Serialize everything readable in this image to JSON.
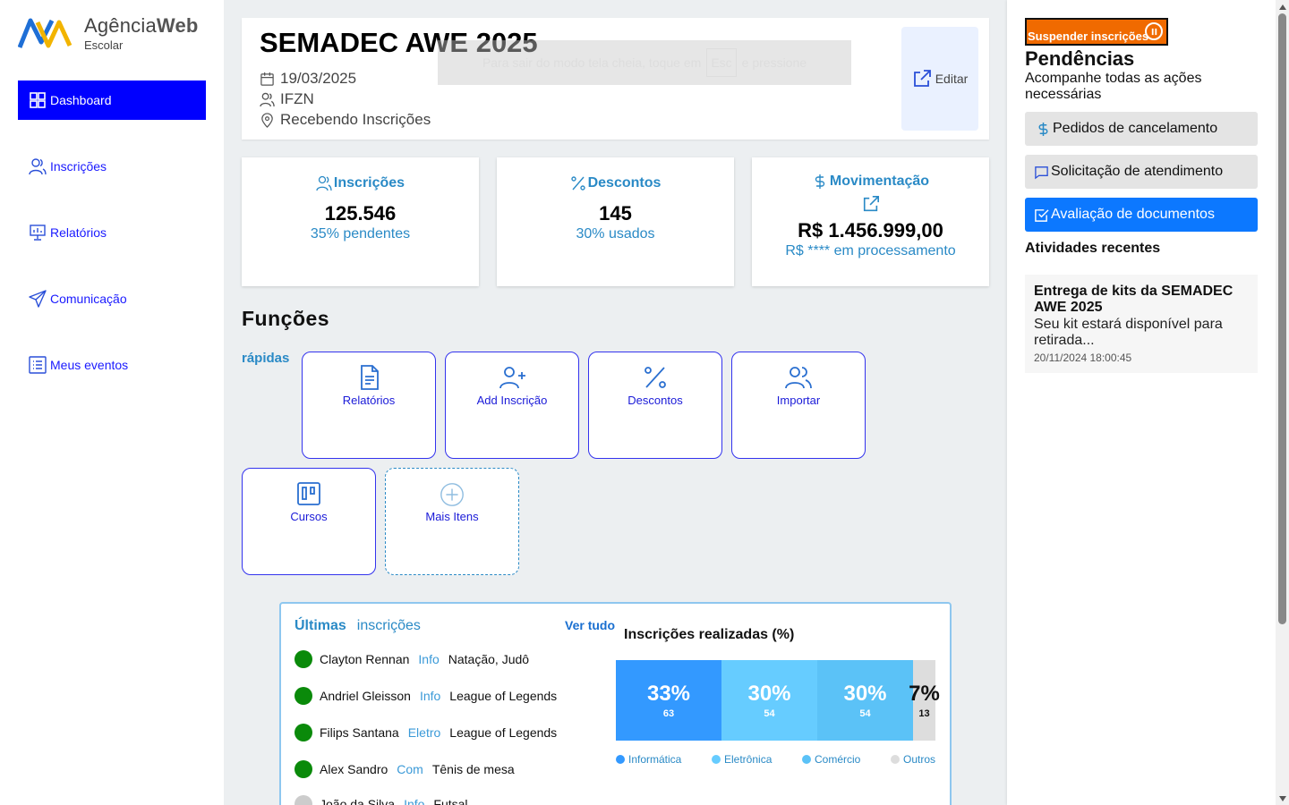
{
  "brand": {
    "name_regular": "Agência",
    "name_bold": "Web",
    "subtitle": "Escolar",
    "colors": {
      "primary": "#0000ff",
      "accent": "#2a8ac6",
      "orange": "#f06a00"
    }
  },
  "sidebar": {
    "items": [
      {
        "label": "Dashboard",
        "icon": "grid-icon",
        "active": true
      },
      {
        "label": "Inscrições",
        "icon": "users-icon"
      },
      {
        "label": "Relatórios",
        "icon": "presentation-icon"
      },
      {
        "label": "Comunicação",
        "icon": "send-icon"
      },
      {
        "label": "Meus eventos",
        "icon": "list-icon"
      }
    ]
  },
  "event": {
    "title": "SEMADEC AWE 2025",
    "date": "19/03/2025",
    "organizer": "IFZN",
    "status": "Recebendo Inscrições",
    "edit_label": "Editar",
    "fullscreen_notice": {
      "before": "Para sair do modo tela cheia, toque em",
      "key": "Esc",
      "after": "e pressione"
    }
  },
  "stats": [
    {
      "title": "Inscrições",
      "icon": "users-icon",
      "value": "125.546",
      "sub": "35% pendentes"
    },
    {
      "title": "Descontos",
      "icon": "percent-icon",
      "value": "145",
      "sub": "30% usados"
    },
    {
      "title": "Movimentação",
      "icon": "dollar-icon",
      "value": "R$ 1.456.999,00",
      "sub": "R$ **** em processamento"
    }
  ],
  "quick": {
    "title": "Funções",
    "subtitle": "rápidas",
    "buttons": [
      {
        "label": "Relatórios",
        "icon": "file-text-icon"
      },
      {
        "label": "Add Inscrição",
        "icon": "user-plus-icon"
      },
      {
        "label": "Descontos",
        "icon": "percent-icon"
      },
      {
        "label": "Importar",
        "icon": "users-icon"
      },
      {
        "label": "Cursos",
        "icon": "kanban-icon"
      },
      {
        "label": "Mais Itens",
        "icon": "plus-circle-icon"
      }
    ]
  },
  "latest": {
    "title_bold": "Últimas",
    "title_rest": "inscrições",
    "see_all": "Ver tudo",
    "rows": [
      {
        "name": "Clayton Rennan",
        "course": "Info",
        "modality": "Natação, Judô",
        "status_color": "green"
      },
      {
        "name": "Andriel Gleisson",
        "course": "Info",
        "modality": "League of Legends",
        "status_color": "green"
      },
      {
        "name": "Filips Santana",
        "course": "Eletro",
        "modality": "League of Legends",
        "status_color": "green"
      },
      {
        "name": "Alex Sandro",
        "course": "Com",
        "modality": "Tênis de mesa",
        "status_color": "green"
      },
      {
        "name": "João da Silva",
        "course": "Info",
        "modality": "Futsal",
        "status_color": "grey"
      }
    ]
  },
  "chart_data": {
    "type": "bar",
    "title": "Inscrições realizadas (%)",
    "categories": [
      "Informática",
      "Eletrônica",
      "Comércio",
      "Outros"
    ],
    "values": [
      33,
      30,
      30,
      7
    ],
    "value_labels": [
      "33%",
      "30%",
      "30%",
      "7%"
    ],
    "counts": [
      63,
      54,
      54,
      13
    ],
    "count_labels": [
      "63",
      "54",
      "54",
      "13"
    ],
    "colors": [
      "#3399ff",
      "#66ccff",
      "#5bc2f7",
      "#dddddd"
    ],
    "legend_position": "bottom"
  },
  "right": {
    "suspend_label": "Suspender inscrições",
    "pending_title": "Pendências",
    "pending_sub": "Acompanhe todas as ações necessárias",
    "pending_items": [
      {
        "label": "Pedidos de cancelamento",
        "icon": "dollar-icon"
      },
      {
        "label": "Solicitação de atendimento",
        "icon": "message-icon"
      },
      {
        "label": "Avaliação de documentos",
        "icon": "check-square-icon",
        "active": true
      }
    ],
    "recent_title": "Atividades recentes",
    "recent": {
      "title": "Entrega de kits da SEMADEC AWE 2025",
      "body": "Seu kit estará disponível para retirada...",
      "time": "20/11/2024 18:00:45"
    }
  }
}
